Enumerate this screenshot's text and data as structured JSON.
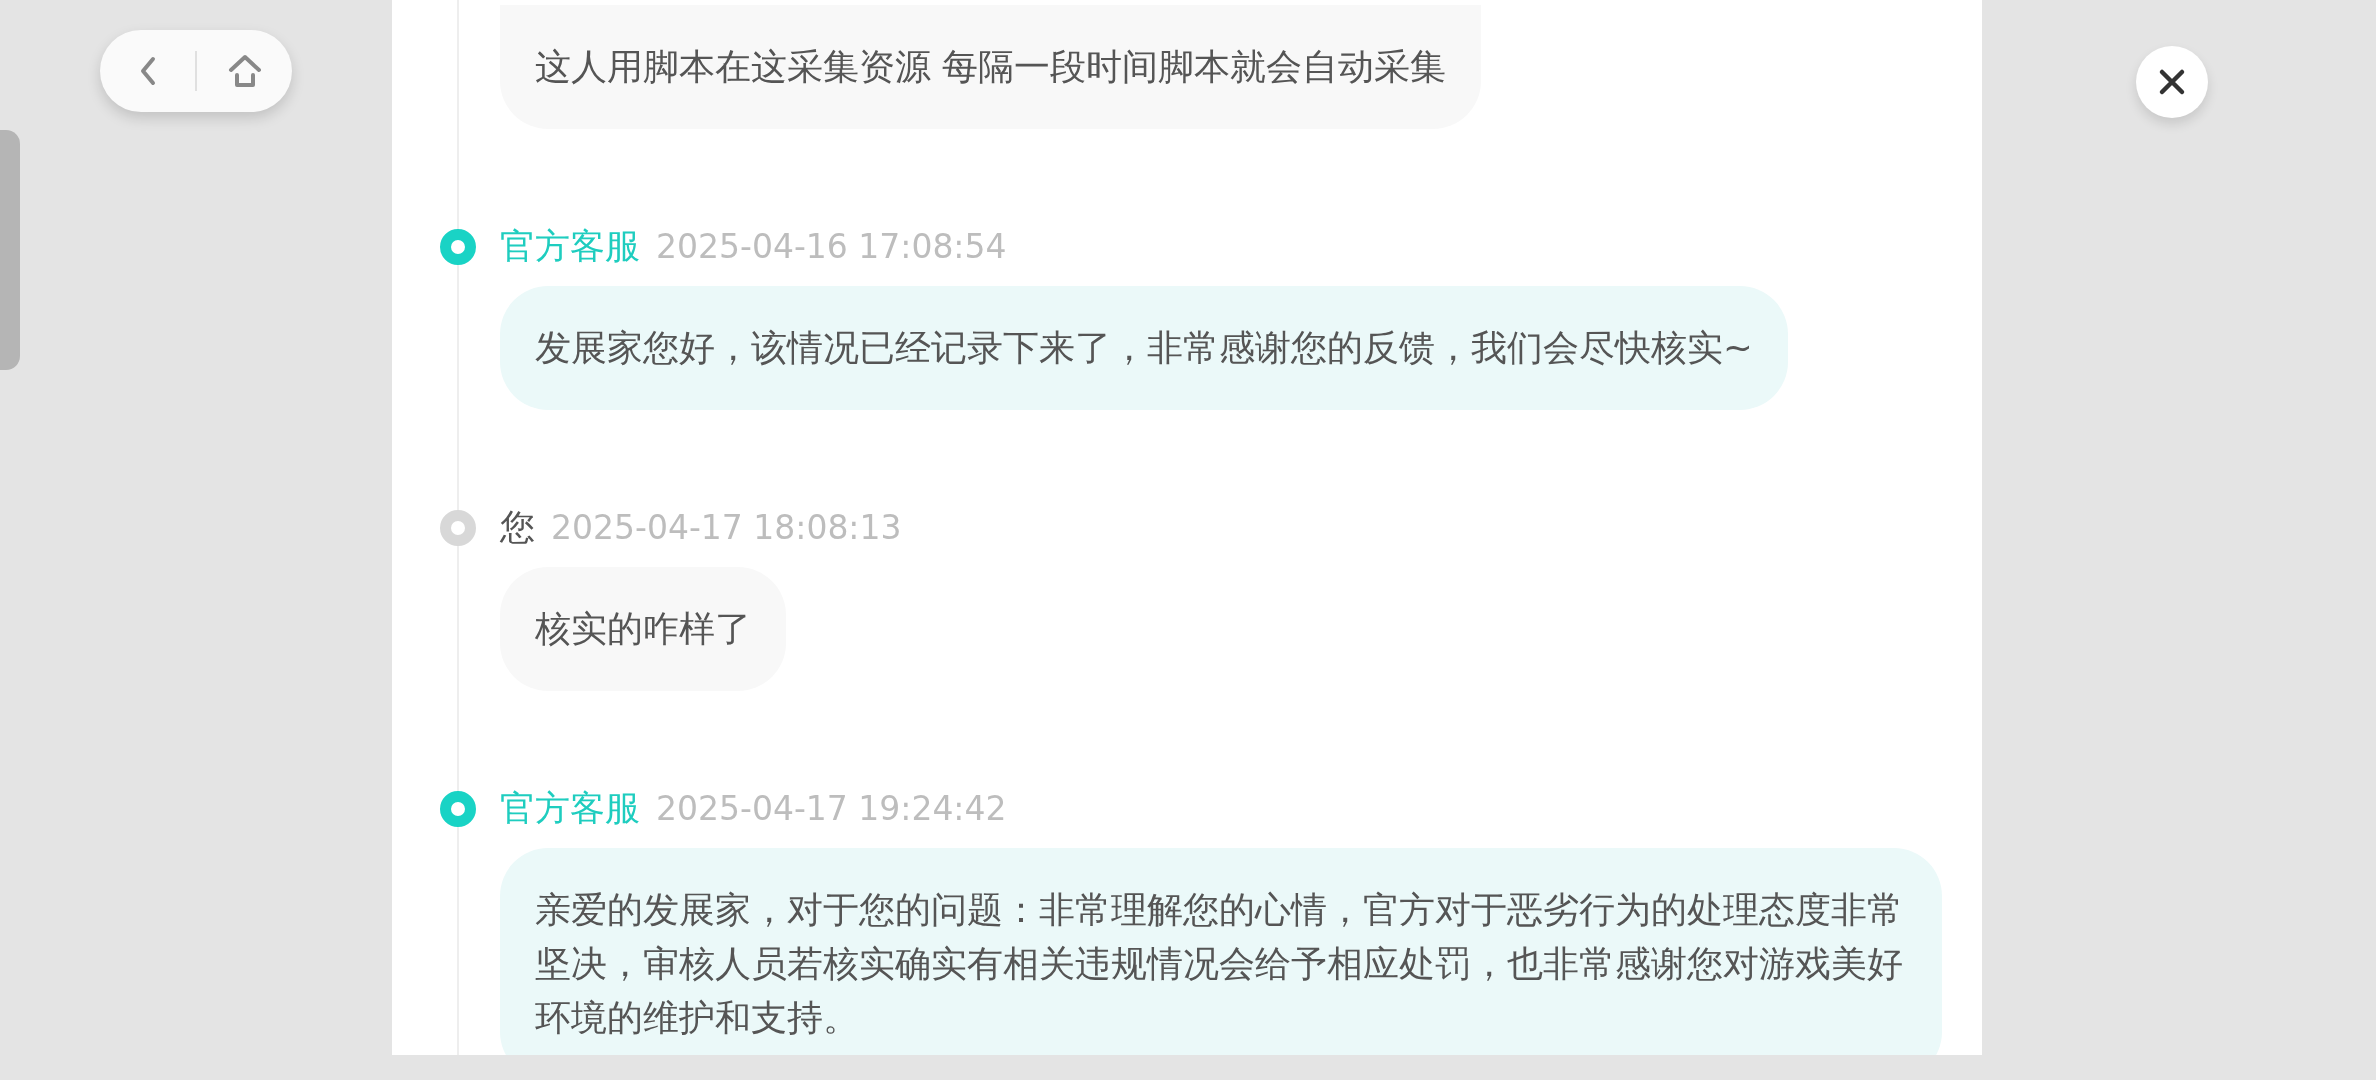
{
  "nav": {
    "buttons": [
      {
        "kind": "back"
      },
      {
        "kind": "home"
      }
    ]
  },
  "close_button": {
    "kind": "close"
  },
  "messages": [
    {
      "text": "这人用脚本在这采集资源 每隔一段时间脚本就会自动采集",
      "kind": "user"
    },
    {
      "sender": "官方客服",
      "time": "2025-04-16 17:08:54",
      "text": "发展家您好，该情况已经记录下来了，非常感谢您的反馈，我们会尽快核实~",
      "kind": "staff"
    },
    {
      "sender": "您",
      "time": "2025-04-17 18:08:13",
      "text": "核实的咋样了",
      "kind": "user"
    },
    {
      "sender": "官方客服",
      "time": "2025-04-17 19:24:42",
      "text": "亲爱的发展家，对于您的问题：非常理解您的心情，官方对于恶劣行为的处理态度非常坚决，审核人员若核实确实有相关违规情况会给予相应处罚，也非常感谢您对游戏美好环境的维护和支持。",
      "kind": "staff"
    }
  ]
}
